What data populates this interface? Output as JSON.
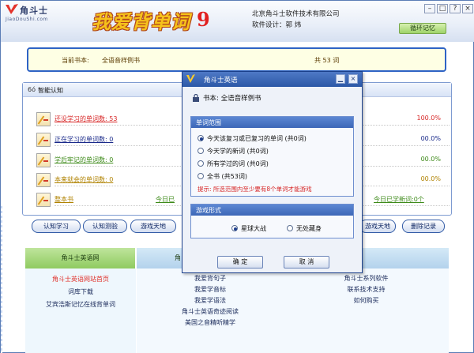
{
  "app": {
    "logo_name": "角斗士",
    "logo_url": "JiaoDouShi.com",
    "brand_title": "我爱背单词",
    "brand_version": "9",
    "company": "北京角斗士软件技术有限公司",
    "designer": "软件设计：郭 炜",
    "mode_tab": "循环记忆"
  },
  "book_bar": {
    "label": "当前书本:",
    "book": "全语音样例书",
    "count": "共 53 词"
  },
  "panel": {
    "title": "智能认知",
    "rows": [
      {
        "label": "还没学习的单词数: 53",
        "pct": "100.0%"
      },
      {
        "label": "正在学习的单词数: 0",
        "pct": "00.0%"
      },
      {
        "label": "学后牢记的单词数: 0",
        "pct": "00.0%"
      },
      {
        "label": "本来就会的单词数: 0",
        "pct": "00.0%"
      },
      {
        "label": "整本书",
        "mid": "今日已",
        "right": "今日已学新词:0个"
      }
    ]
  },
  "toolbar": {
    "b1": "认知学习",
    "b2": "认知测验",
    "b3": "游戏天地",
    "b4": "游戏天地",
    "b5": "删除记录"
  },
  "bottom": {
    "tab1": "角斗士英语网",
    "tab2": "角",
    "col1": [
      "角斗士英语网站首页",
      "词库下载",
      "艾宾浩斯记忆在线背单词"
    ],
    "col2": [
      "我爱背句子",
      "我爱学音标",
      "我爱学语法",
      "角斗士英语奇迹阅读",
      "美国之音精听精学"
    ],
    "col3": [
      "角斗士系列软件",
      "联系技术支持",
      "如何购买"
    ]
  },
  "dialog": {
    "title": "角斗士英语",
    "book_label": "书本: 全语音样例书",
    "scope_title": "单词范围",
    "scope_options": [
      "今天该复习或已复习的单词 (共0词)",
      "今天学的新词 (共0词)",
      "所有学过的词 (共0词)",
      "全书 (共53词)"
    ],
    "hint": "提示: 所选范围内至少要有8个单词才能游戏",
    "game_title": "游戏形式",
    "game_options": [
      "星球大战",
      "无处藏身"
    ],
    "ok": "确 定",
    "cancel": "取 消"
  },
  "colors": {
    "accent_blue": "#2e63c5",
    "red": "#d72727",
    "green": "#3d8a19"
  }
}
